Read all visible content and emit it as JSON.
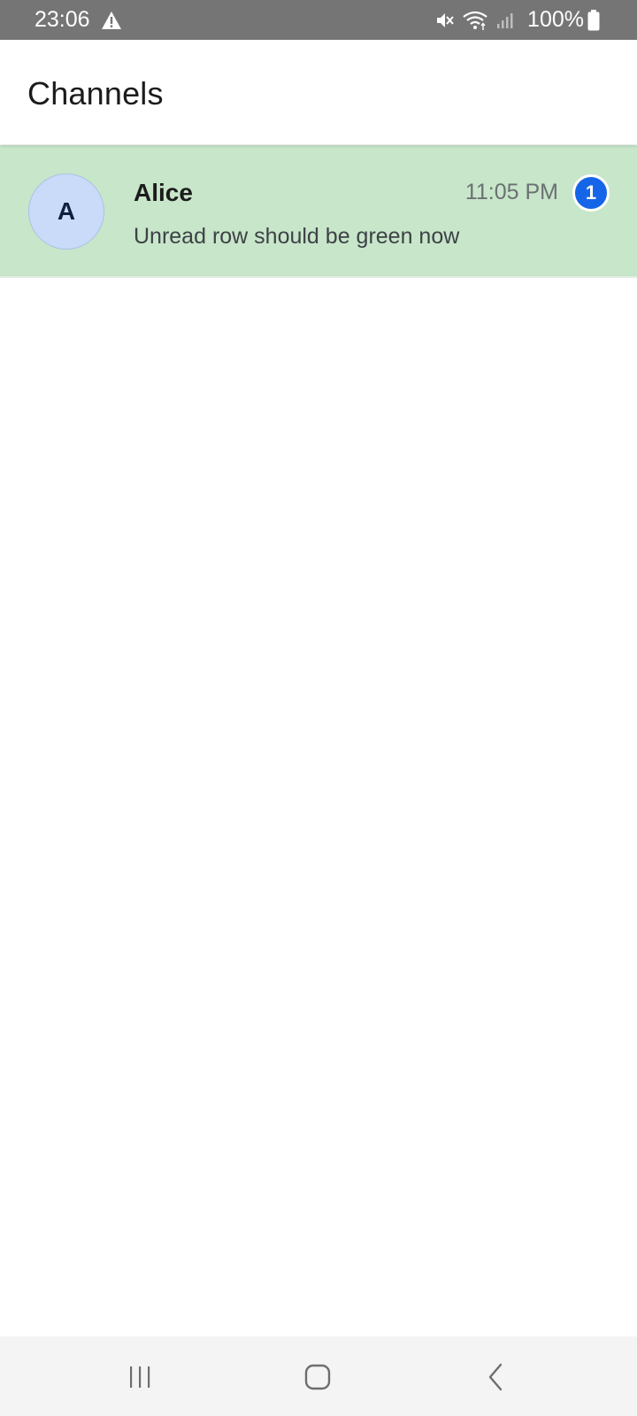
{
  "status_bar": {
    "time": "23:06",
    "battery": "100%",
    "icons": [
      "alert-icon",
      "mute-icon",
      "wifi-icon",
      "signal-icon",
      "battery-icon"
    ]
  },
  "header": {
    "title": "Channels"
  },
  "channels": [
    {
      "avatar_letter": "A",
      "name": "Alice",
      "time": "11:05 PM",
      "unread_count": "1",
      "preview": "Unread row should be green now"
    }
  ],
  "nav_bar": {
    "icons": [
      "recents-icon",
      "home-icon",
      "back-icon"
    ]
  },
  "colors": {
    "status_bar_bg": "#757575",
    "unread_row_bg": "#c8e6c9",
    "avatar_bg": "#c9dbf9",
    "badge_bg": "#1565e8",
    "nav_bar_bg": "#f4f4f4"
  }
}
